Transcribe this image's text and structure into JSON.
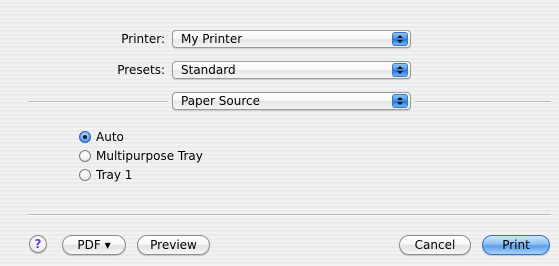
{
  "printer": {
    "label": "Printer:",
    "value": "My Printer"
  },
  "presets": {
    "label": "Presets:",
    "value": "Standard"
  },
  "panel": {
    "value": "Paper Source"
  },
  "paper_source": {
    "options": [
      {
        "label": "Auto",
        "checked": true
      },
      {
        "label": "Multipurpose Tray",
        "checked": false
      },
      {
        "label": "Tray 1",
        "checked": false
      }
    ]
  },
  "bottom_bar": {
    "help_label": "?",
    "pdf_label": "PDF ▾",
    "preview_label": "Preview",
    "cancel_label": "Cancel",
    "print_label": "Print"
  },
  "colors": {
    "accent": "#5a9de9",
    "help_glyph": "#6a3ad1"
  }
}
